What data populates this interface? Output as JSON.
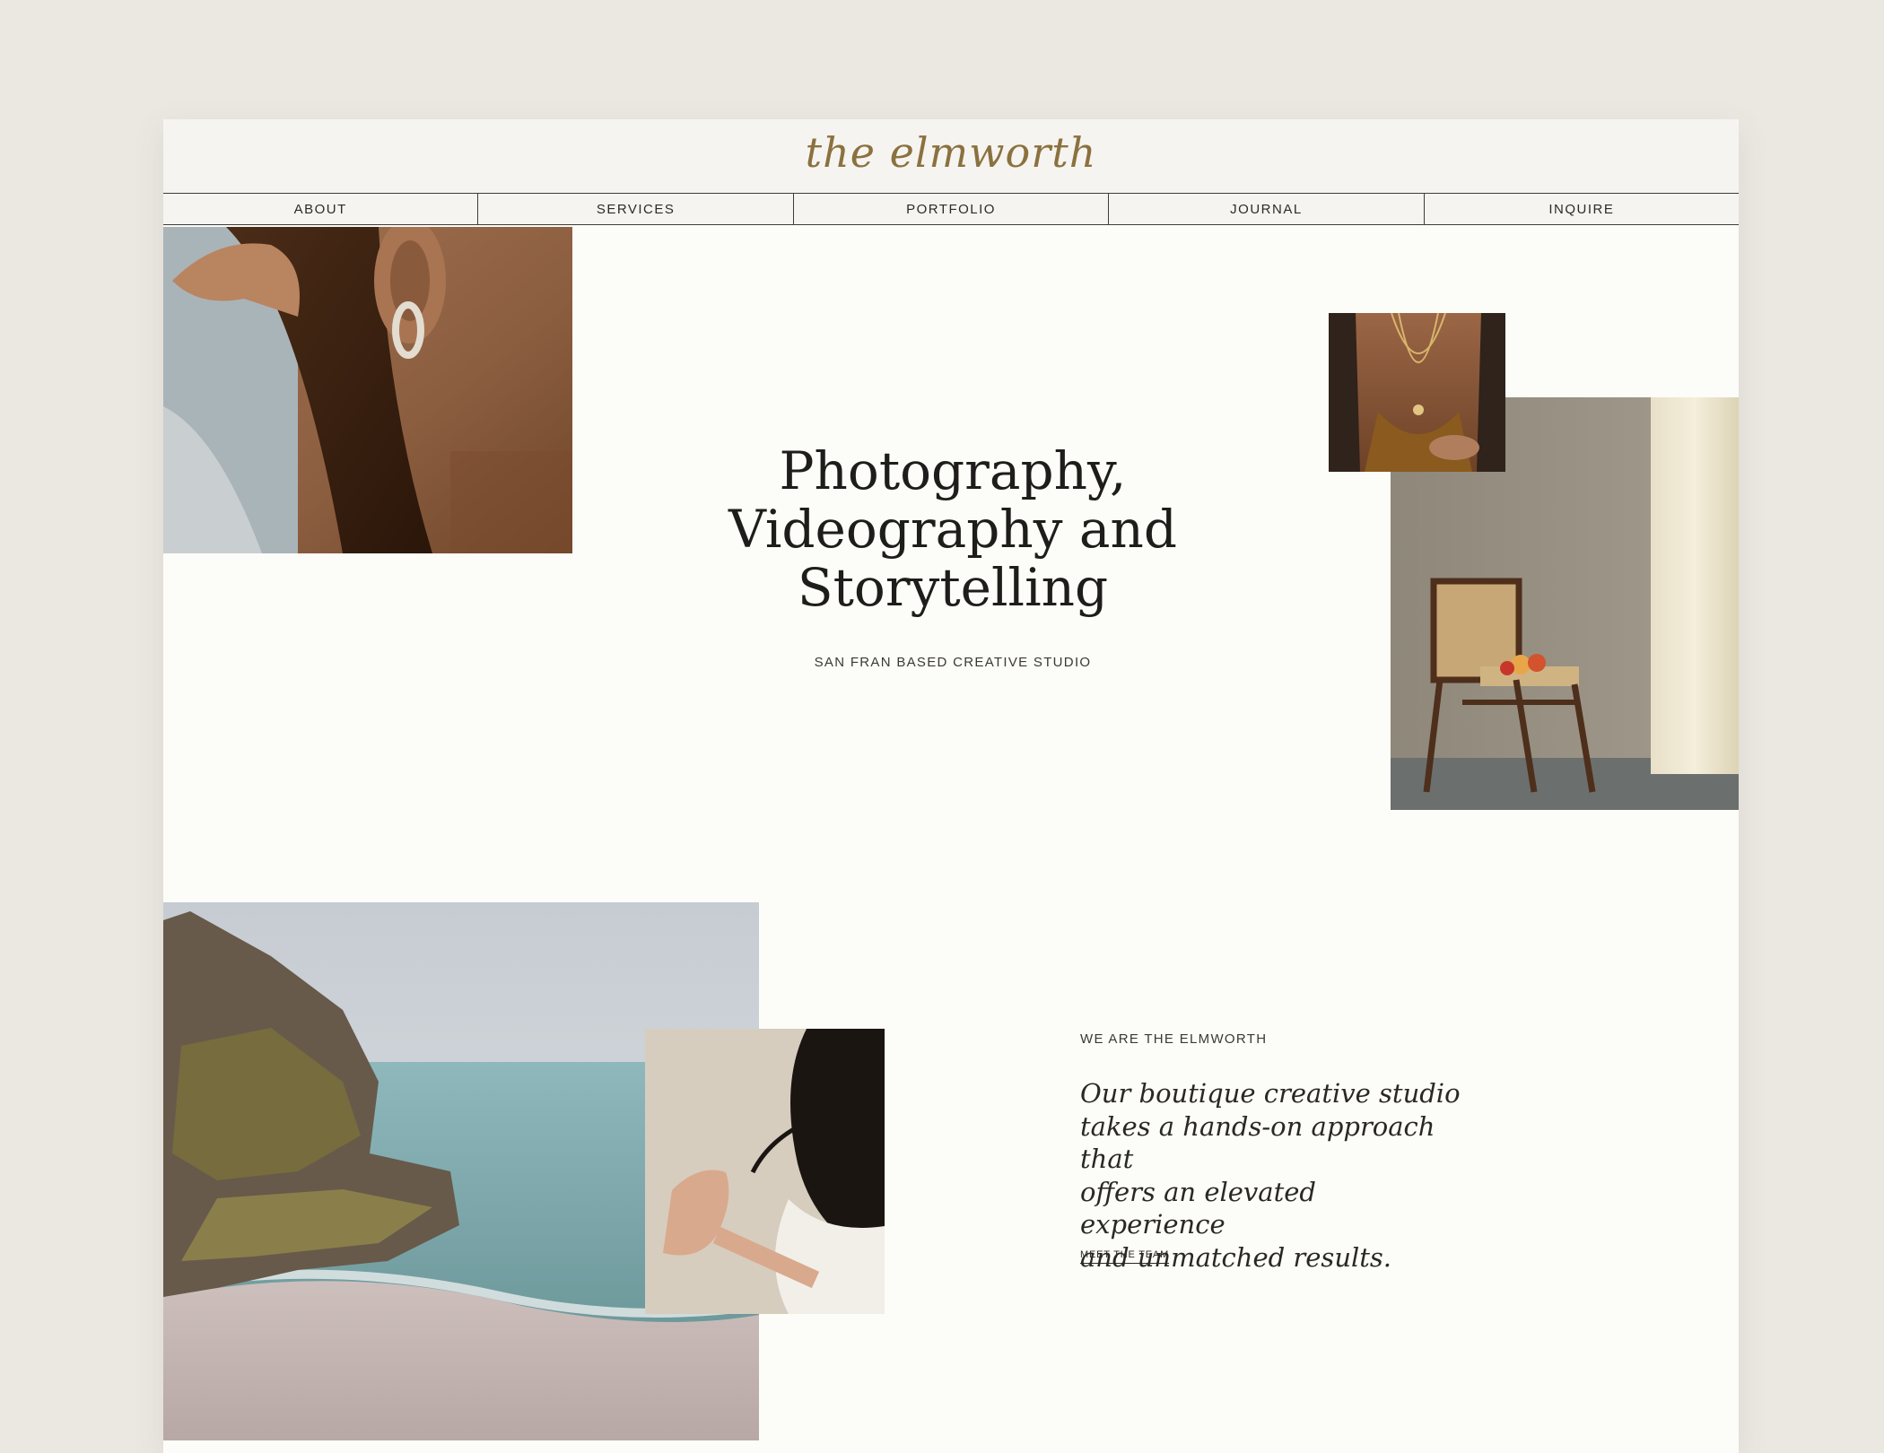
{
  "header": {
    "logo": "the elmworth"
  },
  "nav": {
    "items": [
      {
        "label": "ABOUT"
      },
      {
        "label": "SERVICES"
      },
      {
        "label": "PORTFOLIO"
      },
      {
        "label": "JOURNAL"
      },
      {
        "label": "INQUIRE"
      }
    ]
  },
  "hero": {
    "title_line_1": "Photography,",
    "title_line_2": "Videography and",
    "title_line_3": "Storytelling",
    "subtitle": "SAN FRAN BASED CREATIVE STUDIO"
  },
  "about": {
    "eyebrow": "WE ARE THE ELMWORTH",
    "quote_line_1": "Our boutique creative studio",
    "quote_line_2": "takes a hands-on approach that",
    "quote_line_3": "offers an elevated experience",
    "quote_line_4": "and unmatched results.",
    "link": "MEET THE TEAM"
  },
  "colors": {
    "page_background": "#ebe8e2",
    "site_background": "#fcfcf9",
    "header_background": "#f6f4f0",
    "logo_gold": "#8a713f",
    "text_dark": "#1e1d1b"
  }
}
